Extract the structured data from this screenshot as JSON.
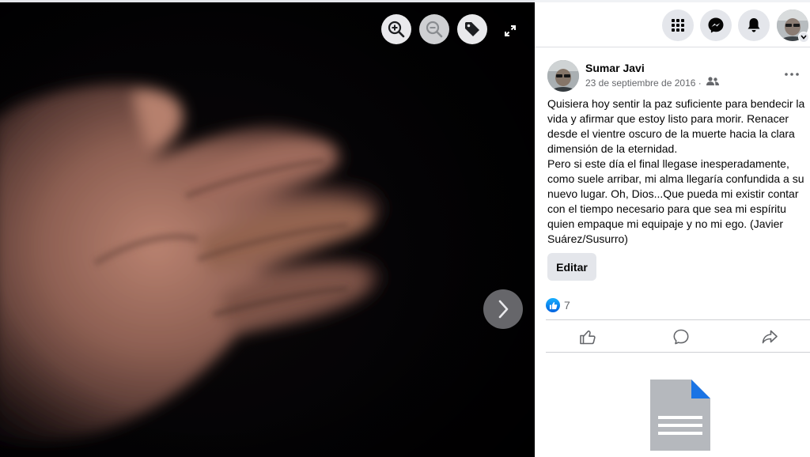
{
  "viewer": {
    "zoom_in_icon": "zoom-in-icon",
    "zoom_out_icon": "zoom-out-icon",
    "tag_icon": "tag-icon",
    "fullscreen_icon": "expand-icon",
    "next_icon": "chevron-right-icon"
  },
  "topbar": {
    "menu_icon": "grid-menu-icon",
    "messenger_icon": "messenger-icon",
    "notifications_icon": "bell-icon",
    "account_caret_icon": "chevron-down-icon"
  },
  "post": {
    "author": "Sumar Javi",
    "date": "23 de septiembre de 2016 ·",
    "audience_icon": "friends-icon",
    "text": [
      "Quisiera hoy sentir la paz suficiente para bendecir la vida y afirmar que estoy listo para morir. Renacer desde el vientre oscuro de la muerte hacia la clara dimensión de la eternidad.",
      "Pero si este día el final llegase inesperadamente, como suele arribar, mi alma llegaría confundida a su nuevo lugar. Oh, Dios...Que pueda mi existir contar con el tiempo necesario para que sea mi espíritu quien empaque mi equipaje y no mi ego. (Javier Suárez/Susurro)"
    ],
    "edit_label": "Editar",
    "reaction_count": "7",
    "actions": {
      "like_icon": "thumbs-up-icon",
      "comment_icon": "comment-icon",
      "share_icon": "share-icon"
    }
  },
  "colors": {
    "accent": "#1877f2",
    "button_bg": "#e4e6eb",
    "secondary_text": "#65676b"
  }
}
